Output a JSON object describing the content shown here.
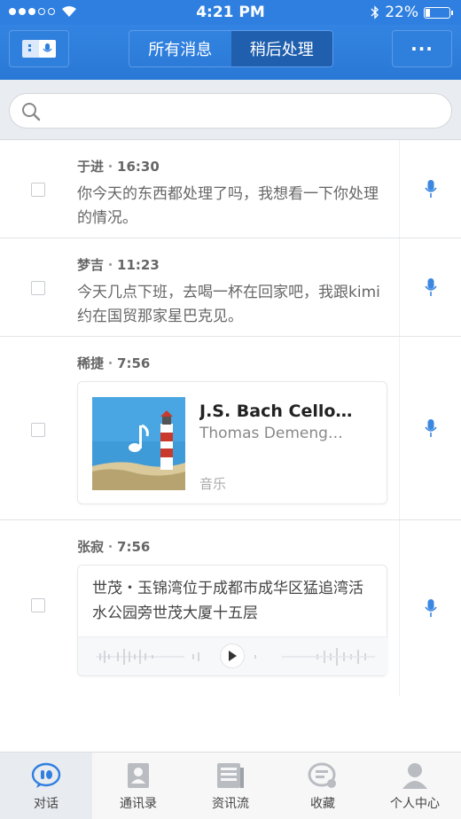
{
  "status_bar": {
    "time": "4:21 PM",
    "battery": "22%"
  },
  "nav": {
    "tabs": [
      {
        "label": "所有消息"
      },
      {
        "label": "稍后处理"
      }
    ],
    "more_label": "···"
  },
  "search": {
    "placeholder": ""
  },
  "messages": [
    {
      "sender": "于进",
      "time": "16:30",
      "text": "你今天的东西都处理了吗，我想看一下你处理的情况。"
    },
    {
      "sender": "梦吉",
      "time": "11:23",
      "text": "今天几点下班，去喝一杯在回家吧，我跟kimi约在国贸那家星巴克见。"
    },
    {
      "sender": "稀捷",
      "time": "7:56",
      "music": {
        "title": "J.S. Bach Cello…",
        "artist": "Thomas Demeng…",
        "tag": "音乐"
      }
    },
    {
      "sender": "张寂",
      "time": "7:56",
      "location": {
        "text": "世茂・玉锦湾位于成都市成华区猛追湾活水公园旁世茂大厦十五层"
      }
    }
  ],
  "separator": "・",
  "tabbar": [
    {
      "label": "对话",
      "icon": "chat-icon"
    },
    {
      "label": "通讯录",
      "icon": "contacts-icon"
    },
    {
      "label": "资讯流",
      "icon": "news-icon"
    },
    {
      "label": "收藏",
      "icon": "favorites-icon"
    },
    {
      "label": "个人中心",
      "icon": "profile-icon"
    }
  ],
  "colors": {
    "accent": "#2e7fe0",
    "mic": "#3a86e0"
  }
}
